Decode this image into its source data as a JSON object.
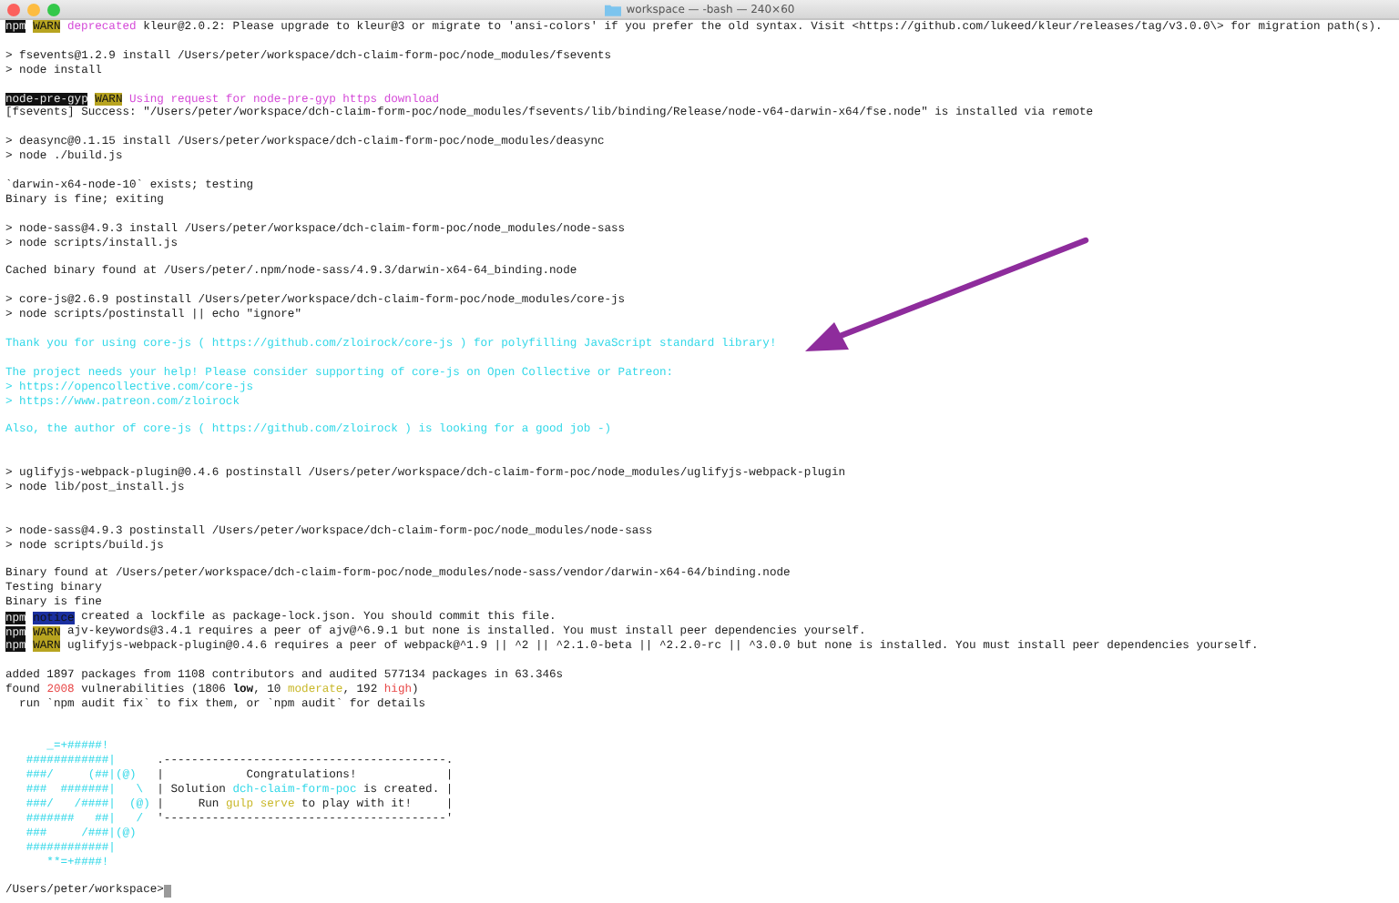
{
  "window": {
    "title": "workspace — -bash — 240×60"
  },
  "terminal": {
    "lines": [
      {
        "kind": "text",
        "spans": [
          {
            "text": "npm",
            "kind": "label"
          },
          {
            "text": "WARN",
            "kind": "warn"
          },
          {
            "text": "deprecated",
            "kind": "magenta"
          },
          {
            "text": " kleur@2.0.2: Please upgrade to kleur@3 or migrate to 'ansi-colors' if you prefer the old syntax. Visit <https://github.com/lukeed/kleur/releases/tag/v3.0.0\\> for migration path(s).",
            "kind": "plain"
          }
        ]
      },
      {
        "kind": "blank"
      },
      {
        "kind": "text",
        "spans": [
          {
            "text": "> fsevents@1.2.9 install /Users/peter/workspace/dch-claim-form-poc/node_modules/fsevents",
            "kind": "plain"
          }
        ]
      },
      {
        "kind": "text",
        "spans": [
          {
            "text": "> node install",
            "kind": "plain"
          }
        ]
      },
      {
        "kind": "blank"
      },
      {
        "kind": "text",
        "spans": [
          {
            "text": "node-pre-gyp",
            "kind": "label"
          },
          {
            "text": "WARN",
            "kind": "warn"
          },
          {
            "text": "Using request for node-pre-gyp https download",
            "kind": "magenta"
          }
        ]
      },
      {
        "kind": "text",
        "spans": [
          {
            "text": "[fsevents] Success: \"/Users/peter/workspace/dch-claim-form-poc/node_modules/fsevents/lib/binding/Release/node-v64-darwin-x64/fse.node\" is installed via remote",
            "kind": "plain"
          }
        ]
      },
      {
        "kind": "blank"
      },
      {
        "kind": "text",
        "spans": [
          {
            "text": "> deasync@0.1.15 install /Users/peter/workspace/dch-claim-form-poc/node_modules/deasync",
            "kind": "plain"
          }
        ]
      },
      {
        "kind": "text",
        "spans": [
          {
            "text": "> node ./build.js",
            "kind": "plain"
          }
        ]
      },
      {
        "kind": "blank"
      },
      {
        "kind": "text",
        "spans": [
          {
            "text": "`darwin-x64-node-10` exists; testing",
            "kind": "plain"
          }
        ]
      },
      {
        "kind": "text",
        "spans": [
          {
            "text": "Binary is fine; exiting",
            "kind": "plain"
          }
        ]
      },
      {
        "kind": "blank"
      },
      {
        "kind": "text",
        "spans": [
          {
            "text": "> node-sass@4.9.3 install /Users/peter/workspace/dch-claim-form-poc/node_modules/node-sass",
            "kind": "plain"
          }
        ]
      },
      {
        "kind": "text",
        "spans": [
          {
            "text": "> node scripts/install.js",
            "kind": "plain"
          }
        ]
      },
      {
        "kind": "blank"
      },
      {
        "kind": "text",
        "spans": [
          {
            "text": "Cached binary found at /Users/peter/.npm/node-sass/4.9.3/darwin-x64-64_binding.node",
            "kind": "plain"
          }
        ]
      },
      {
        "kind": "blank"
      },
      {
        "kind": "text",
        "spans": [
          {
            "text": "> core-js@2.6.9 postinstall /Users/peter/workspace/dch-claim-form-poc/node_modules/core-js",
            "kind": "plain"
          }
        ]
      },
      {
        "kind": "text",
        "spans": [
          {
            "text": "> node scripts/postinstall || echo \"ignore\"",
            "kind": "plain"
          }
        ]
      },
      {
        "kind": "blank"
      },
      {
        "kind": "text",
        "spans": [
          {
            "text": "Thank you for using core-js ( https://github.com/zloirock/core-js ) for polyfilling JavaScript standard library!",
            "kind": "cyan"
          }
        ]
      },
      {
        "kind": "blank"
      },
      {
        "kind": "text",
        "spans": [
          {
            "text": "The project needs your help! Please consider supporting of core-js on Open Collective or Patreon:",
            "kind": "cyan"
          }
        ]
      },
      {
        "kind": "text",
        "spans": [
          {
            "text": "> https://opencollective.com/core-js",
            "kind": "cyan"
          }
        ]
      },
      {
        "kind": "text",
        "spans": [
          {
            "text": "> https://www.patreon.com/zloirock",
            "kind": "cyan"
          }
        ]
      },
      {
        "kind": "blank"
      },
      {
        "kind": "text",
        "spans": [
          {
            "text": "Also, the author of core-js ( https://github.com/zloirock ) is looking for a good job -)",
            "kind": "cyan"
          }
        ]
      },
      {
        "kind": "blank"
      },
      {
        "kind": "blank"
      },
      {
        "kind": "text",
        "spans": [
          {
            "text": "> uglifyjs-webpack-plugin@0.4.6 postinstall /Users/peter/workspace/dch-claim-form-poc/node_modules/uglifyjs-webpack-plugin",
            "kind": "plain"
          }
        ]
      },
      {
        "kind": "text",
        "spans": [
          {
            "text": "> node lib/post_install.js",
            "kind": "plain"
          }
        ]
      },
      {
        "kind": "blank"
      },
      {
        "kind": "blank"
      },
      {
        "kind": "text",
        "spans": [
          {
            "text": "> node-sass@4.9.3 postinstall /Users/peter/workspace/dch-claim-form-poc/node_modules/node-sass",
            "kind": "plain"
          }
        ]
      },
      {
        "kind": "text",
        "spans": [
          {
            "text": "> node scripts/build.js",
            "kind": "plain"
          }
        ]
      },
      {
        "kind": "blank"
      },
      {
        "kind": "text",
        "spans": [
          {
            "text": "Binary found at /Users/peter/workspace/dch-claim-form-poc/node_modules/node-sass/vendor/darwin-x64-64/binding.node",
            "kind": "plain"
          }
        ]
      },
      {
        "kind": "text",
        "spans": [
          {
            "text": "Testing binary",
            "kind": "plain"
          }
        ]
      },
      {
        "kind": "text",
        "spans": [
          {
            "text": "Binary is fine",
            "kind": "plain"
          }
        ]
      },
      {
        "kind": "text",
        "spans": [
          {
            "text": "npm",
            "kind": "label"
          },
          {
            "text": "notice",
            "kind": "notice"
          },
          {
            "text": "created a lockfile as package-lock.json. You should commit this file.",
            "kind": "plain"
          }
        ]
      },
      {
        "kind": "text",
        "spans": [
          {
            "text": "npm",
            "kind": "label"
          },
          {
            "text": "WARN",
            "kind": "warn"
          },
          {
            "text": "ajv-keywords@3.4.1 requires a peer of ajv@^6.9.1 but none is installed. You must install peer dependencies yourself.",
            "kind": "plain"
          }
        ]
      },
      {
        "kind": "text",
        "spans": [
          {
            "text": "npm",
            "kind": "label"
          },
          {
            "text": "WARN",
            "kind": "warn"
          },
          {
            "text": "uglifyjs-webpack-plugin@0.4.6 requires a peer of webpack@^1.9 || ^2 || ^2.1.0-beta || ^2.2.0-rc || ^3.0.0 but none is installed. You must install peer dependencies yourself.",
            "kind": "plain"
          }
        ]
      },
      {
        "kind": "blank"
      },
      {
        "kind": "text",
        "spans": [
          {
            "text": "added 1897 packages from 1108 contributors and audited 577134 packages in 63.346s",
            "kind": "plain"
          }
        ]
      },
      {
        "kind": "text",
        "spans": [
          {
            "text": "found ",
            "kind": "plain"
          },
          {
            "text": "2008",
            "kind": "red"
          },
          {
            "text": " vulnerabilities (1806 ",
            "kind": "plain"
          },
          {
            "text": "low",
            "kind": "bold"
          },
          {
            "text": ", 10 ",
            "kind": "plain"
          },
          {
            "text": "moderate",
            "kind": "yellow"
          },
          {
            "text": ", 192 ",
            "kind": "plain"
          },
          {
            "text": "high",
            "kind": "red"
          },
          {
            "text": ")",
            "kind": "plain"
          }
        ]
      },
      {
        "kind": "text",
        "spans": [
          {
            "text": "  run `npm audit fix` to fix them, or `npm audit` for details",
            "kind": "plain"
          }
        ]
      },
      {
        "kind": "blank"
      },
      {
        "kind": "blank"
      },
      {
        "kind": "text",
        "spans": [
          {
            "text": "      _=+#####!",
            "kind": "cyan"
          }
        ]
      },
      {
        "kind": "text",
        "spans": [
          {
            "text": "   ############|      ",
            "kind": "cyan"
          },
          {
            "text": ".-----------------------------------------.",
            "kind": "plain"
          }
        ]
      },
      {
        "kind": "text",
        "spans": [
          {
            "text": "   ###/     (##|(@)   ",
            "kind": "cyan"
          },
          {
            "text": "|            Congratulations!             |",
            "kind": "plain"
          }
        ]
      },
      {
        "kind": "text",
        "spans": [
          {
            "text": "   ###  #######|   \\  ",
            "kind": "cyan"
          },
          {
            "text": "| Solution ",
            "kind": "plain"
          },
          {
            "text": "dch-claim-form-poc",
            "kind": "cyan"
          },
          {
            "text": " is created. |",
            "kind": "plain"
          }
        ]
      },
      {
        "kind": "text",
        "spans": [
          {
            "text": "   ###/   /####|  (@) ",
            "kind": "cyan"
          },
          {
            "text": "|     Run ",
            "kind": "plain"
          },
          {
            "text": "gulp serve",
            "kind": "yellow"
          },
          {
            "text": " to play with it!     |",
            "kind": "plain"
          }
        ]
      },
      {
        "kind": "text",
        "spans": [
          {
            "text": "   #######   ##|   /  ",
            "kind": "cyan"
          },
          {
            "text": "'-----------------------------------------'",
            "kind": "plain"
          }
        ]
      },
      {
        "kind": "text",
        "spans": [
          {
            "text": "   ###     /###|(@)",
            "kind": "cyan"
          }
        ]
      },
      {
        "kind": "text",
        "spans": [
          {
            "text": "   ############|",
            "kind": "cyan"
          }
        ]
      },
      {
        "kind": "text",
        "spans": [
          {
            "text": "      **=+####!",
            "kind": "cyan"
          }
        ]
      },
      {
        "kind": "blank"
      },
      {
        "kind": "prompt",
        "spans": [
          {
            "text": "/Users/peter/workspace>",
            "kind": "plain"
          }
        ]
      }
    ]
  }
}
